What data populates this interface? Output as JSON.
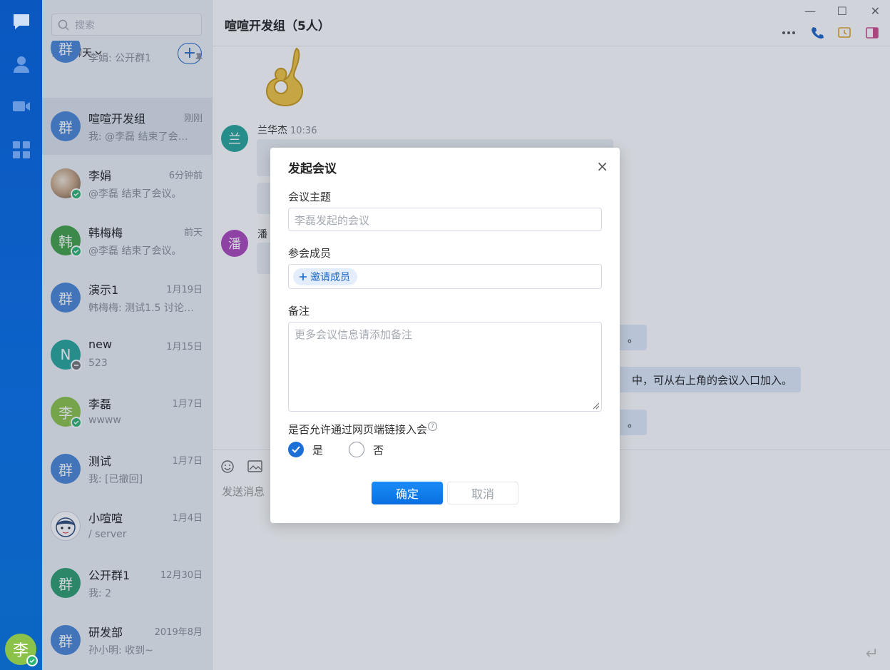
{
  "window": {
    "minimize": "—",
    "maximize": "☐",
    "close": "✕"
  },
  "sidebar": {
    "user_avatar": "李"
  },
  "conversations": {
    "search_placeholder": "搜索",
    "filter_label": "最近聊天",
    "add_label": "+",
    "items": [
      {
        "avatar": "群",
        "avatar_color": "#4a86d8",
        "name": "",
        "time": "",
        "preview": "李娟: 公开群1",
        "pinned": true
      },
      {
        "avatar": "群",
        "avatar_color": "#4a86d8",
        "name": "喧喧开发组",
        "time": "刚刚",
        "preview": "我: @李磊 结束了会…"
      },
      {
        "avatar": "",
        "avatar_color": "#b98b6a",
        "name": "李娟",
        "time": "6分钟前",
        "preview": "@李磊 结束了会议。"
      },
      {
        "avatar": "韩",
        "avatar_color": "#43a047",
        "name": "韩梅梅",
        "time": "前天",
        "preview": "@李磊 结束了会议。"
      },
      {
        "avatar": "群",
        "avatar_color": "#4a86d8",
        "name": "演示1",
        "time": "1月19日",
        "preview": "韩梅梅: 测试1.5 讨论…"
      },
      {
        "avatar": "N",
        "avatar_color": "#26a69a",
        "name": "new",
        "time": "1月15日",
        "preview": "523"
      },
      {
        "avatar": "李",
        "avatar_color": "#8bc34a",
        "name": "李磊",
        "time": "1月7日",
        "preview": "wwww"
      },
      {
        "avatar": "群",
        "avatar_color": "#4a86d8",
        "name": "测试",
        "time": "1月7日",
        "preview": "我: [已撤回]"
      },
      {
        "avatar": "",
        "avatar_color": "#ffffff",
        "name": "小喧喧",
        "time": "1月4日",
        "preview": "/ server"
      },
      {
        "avatar": "群",
        "avatar_color": "#2e9e6f",
        "name": "公开群1",
        "time": "12月30日",
        "preview": "我: 2"
      },
      {
        "avatar": "群",
        "avatar_color": "#4a86d8",
        "name": "研发部",
        "time": "2019年8月",
        "preview": "孙小明: 收到~"
      }
    ]
  },
  "chat": {
    "title": "喧喧开发组（5人）",
    "messages": [
      {
        "avatar": "兰",
        "avatar_color": "#26a69a",
        "sender": "兰华杰",
        "time": "10:36"
      },
      {
        "avatar": "潘",
        "avatar_color": "#ab47bc",
        "sender": "潘"
      }
    ],
    "system_notice_tail_1": "。",
    "system_notice_tail_2": "中，可从右上角的会议入口加入。",
    "system_notice_tail_3": "。",
    "composer_placeholder": "发送消息"
  },
  "dialog": {
    "title": "发起会议",
    "close": "×",
    "topic_label": "会议主题",
    "topic_placeholder": "李磊发起的会议",
    "members_label": "参会成员",
    "invite_label": "邀请成员",
    "note_label": "备注",
    "note_placeholder": "更多会议信息请添加备注",
    "web_join_label": "是否允许通过网页端链接入会",
    "help_glyph": "?",
    "option_yes": "是",
    "option_no": "否",
    "web_join_selected": "是",
    "confirm": "确定",
    "cancel": "取消"
  }
}
